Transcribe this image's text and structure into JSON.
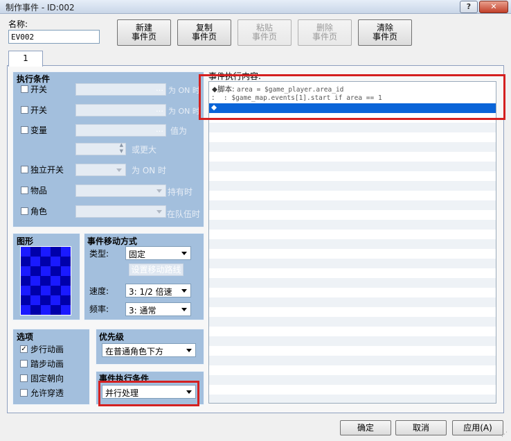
{
  "window": {
    "title": "制作事件 - ID:002",
    "help_glyph": "?",
    "close_glyph": "✕"
  },
  "name_field": {
    "label": "名称:",
    "value": "EV002"
  },
  "toolbar": {
    "new_page": [
      "新建",
      "事件页"
    ],
    "copy_page": [
      "复制",
      "事件页"
    ],
    "paste_page": [
      "粘贴",
      "事件页"
    ],
    "delete_page": [
      "删除",
      "事件页"
    ],
    "clear_page": [
      "清除",
      "事件页"
    ]
  },
  "tabs": [
    {
      "label": "1"
    }
  ],
  "conditions": {
    "title": "执行条件",
    "switch1": {
      "label": "开关",
      "suffix": "为 ON 时"
    },
    "switch2": {
      "label": "开关",
      "suffix": "为 ON 时"
    },
    "variable": {
      "label": "变量",
      "suffix": "值为",
      "suffix2": "或更大"
    },
    "self_switch": {
      "label": "独立开关",
      "suffix": "为 ON 时"
    },
    "item": {
      "label": "物品",
      "suffix": "持有时"
    },
    "actor": {
      "label": "角色",
      "suffix": "在队伍时"
    },
    "more_glyph": "…"
  },
  "graphic": {
    "title": "图形"
  },
  "movement": {
    "title": "事件移动方式",
    "type_label": "类型:",
    "type_value": "固定",
    "route_button": "设置移动路线",
    "speed_label": "速度:",
    "speed_value": "3: 1/2 倍速",
    "freq_label": "频率:",
    "freq_value": "3: 通常"
  },
  "options": {
    "title": "选项",
    "items": [
      {
        "label": "步行动画",
        "checked": true,
        "mark": "✓"
      },
      {
        "label": "踏步动画",
        "checked": false,
        "mark": ""
      },
      {
        "label": "固定朝向",
        "checked": false,
        "mark": ""
      },
      {
        "label": "允许穿透",
        "checked": false,
        "mark": ""
      }
    ]
  },
  "priority": {
    "title": "优先级",
    "value": "在普通角色下方"
  },
  "trigger": {
    "title": "事件执行条件",
    "value": "并行处理"
  },
  "contents": {
    "title": "事件执行内容:",
    "line1_head": "◆脚本:",
    "line1_code": "area = $game_player.area_id",
    "line2_head": ":",
    "line2_code": ": $game_map.events[1].start if area == 1",
    "line3_head": "◆"
  },
  "footer": {
    "ok": "确定",
    "cancel": "取消",
    "apply": "应用(A)"
  },
  "colors": {
    "group_bg": "#a3bfdd",
    "selection": "#0a64d8",
    "highlight_box": "#d42020",
    "graphic_tile_a": "#1a1aff",
    "graphic_tile_b": "#0000aa"
  }
}
